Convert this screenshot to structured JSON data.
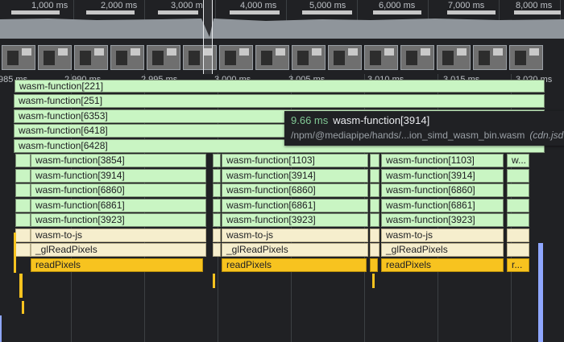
{
  "overview": {
    "tick_labels": [
      "1,000 ms",
      "2,000 ms",
      "3,000 m",
      "4,000 ms",
      "5,000 ms",
      "6,000 ms",
      "7,000 ms",
      "8,000 ms"
    ]
  },
  "detail": {
    "tick_labels": [
      "985 ms",
      "2,990 ms",
      "2,995 ms",
      "3,000 ms",
      "3,005 ms",
      "3,010 ms",
      "3,015 ms",
      "3,020 ms"
    ],
    "top_rows": [
      "wasm-function[221]",
      "wasm-function[251]",
      "wasm-function[6353]",
      "wasm-function[6418]",
      "wasm-function[6428]"
    ],
    "col1": [
      "wasm-function[3854]",
      "wasm-function[3914]",
      "wasm-function[6860]",
      "wasm-function[6861]",
      "wasm-function[3923]",
      "wasm-to-js",
      "_glReadPixels",
      "readPixels"
    ],
    "col2": [
      "wasm-function[1103]",
      "wasm-function[3914]",
      "wasm-function[6860]",
      "wasm-function[6861]",
      "wasm-function[3923]",
      "wasm-to-js",
      "_glReadPixels",
      "readPixels"
    ],
    "col3": [
      "wasm-function[1103]",
      "wasm-function[3914]",
      "wasm-function[6860]",
      "wasm-function[6861]",
      "wasm-function[3923]",
      "wasm-to-js",
      "_glReadPixels",
      "readPixels"
    ],
    "col4_top": "w...",
    "col4_bottom": "r..."
  },
  "tooltip": {
    "duration": "9.66 ms",
    "name": "wasm-function[3914]",
    "url": "/npm/@mediapipe/hands/...ion_simd_wasm_bin.wasm",
    "source": "(cdn.jsd"
  },
  "colors": {
    "wasm": "#c9f5c3",
    "js": "#f6eecd",
    "paint": "#f7c31f",
    "accent": "#8fa7ff"
  }
}
